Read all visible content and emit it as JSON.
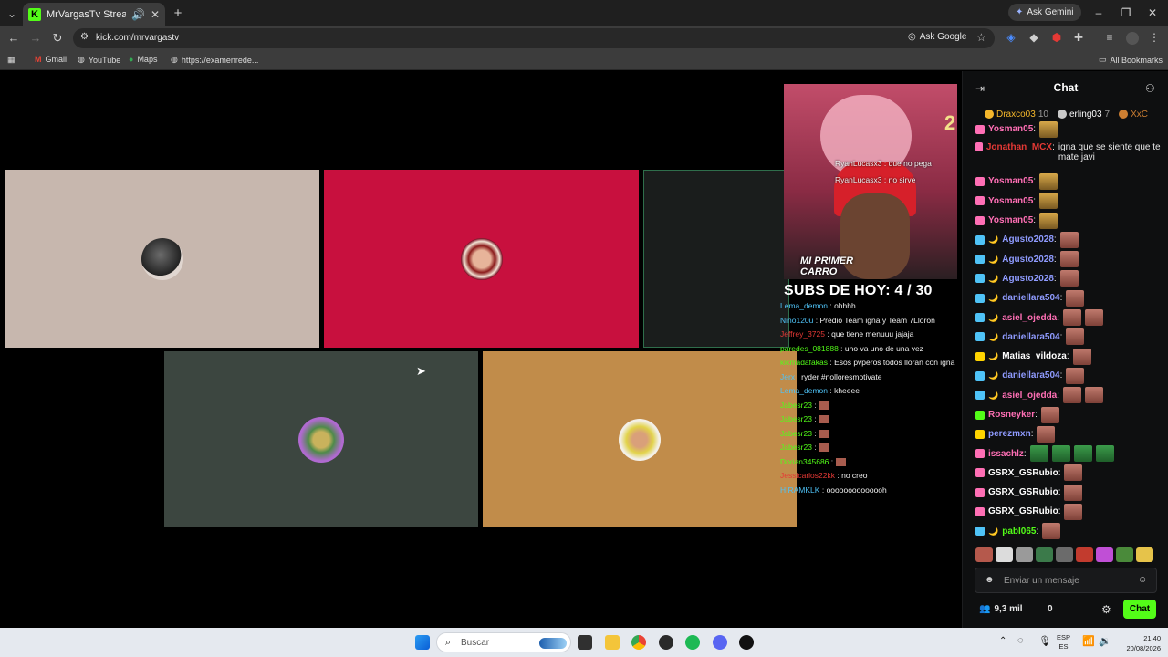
{
  "browser": {
    "tab_title": "MrVargasTv Stream - Watch",
    "url": "kick.com/mrvargastv",
    "ask_google": "Ask Google",
    "ask_gemini": "Ask Gemini",
    "bookmarks": [
      "Gmail",
      "YouTube",
      "Maps",
      "https://examenrede..."
    ],
    "all_bookmarks": "All Bookmarks"
  },
  "stream": {
    "overlay_chat_top": [
      "RyanLucasx3 : que no pega",
      "RyanLucasx3 : no sirve"
    ],
    "cam_label": "MI PRIMER CARRO",
    "subs_banner": "SUBS DE HOY: 4 / 30",
    "overlay_chat": [
      {
        "user": "Lema_demon",
        "msg": "ohhhh",
        "color": "#4fc3f7"
      },
      {
        "user": "Nino120u",
        "msg": "Predio Team igna y Team 7Lloron",
        "color": "#4fc3f7"
      },
      {
        "user": "Jeffrey_3725",
        "msg": "que tiene menuuu jajaja",
        "color": "#e53935"
      },
      {
        "user": "paredes_081888",
        "msg": "uno va uno de una vez",
        "color": "#53fc18"
      },
      {
        "user": "kikmadafakas",
        "msg": "Esos pvperos todos lloran con igna",
        "color": "#53fc18"
      },
      {
        "user": "Jerx",
        "msg": "ryder #nolloresmotivate",
        "color": "#4fc3f7"
      },
      {
        "user": "Lema_demon",
        "msg": "kheeee",
        "color": "#4fc3f7"
      },
      {
        "user": "Jabesr23",
        "msg": "",
        "color": "#53fc18"
      },
      {
        "user": "Jabesr23",
        "msg": "",
        "color": "#53fc18"
      },
      {
        "user": "Jabesr23",
        "msg": "",
        "color": "#53fc18"
      },
      {
        "user": "Jabesr23",
        "msg": "",
        "color": "#53fc18"
      },
      {
        "user": "Dorian345686",
        "msg": "",
        "color": "#53fc18"
      },
      {
        "user": "Jessicarlos22kk",
        "msg": "no creo",
        "color": "#e53935"
      },
      {
        "user": "HIRAMKLK",
        "msg": "oooooooooooooh",
        "color": "#4fc3f7"
      }
    ]
  },
  "chat": {
    "title": "Chat",
    "top_gifters": [
      {
        "name": "Draxco03",
        "count": "10",
        "color": "#f5b72b"
      },
      {
        "name": "erling03",
        "count": "7",
        "color": "#c9c9c9"
      },
      {
        "name": "XxC",
        "count": "",
        "color": "#cd7f32"
      }
    ],
    "messages": [
      {
        "user": "Yosman05",
        "color": "#ff6fb5",
        "text": "",
        "emotes": 1,
        "badge": "#ff6fb5",
        "sub": false
      },
      {
        "user": "Jonathan_MCX",
        "color": "#e53935",
        "text": "igna que se siente que te mate javi",
        "emotes": 0,
        "badge": "#ff6fb5",
        "sub": false
      },
      {
        "user": "Yosman05",
        "color": "#ff6fb5",
        "text": "",
        "emotes": 1,
        "badge": "#ff6fb5",
        "sub": false
      },
      {
        "user": "Yosman05",
        "color": "#ff6fb5",
        "text": "",
        "emotes": 1,
        "badge": "#ff6fb5",
        "sub": false
      },
      {
        "user": "Yosman05",
        "color": "#ff6fb5",
        "text": "",
        "emotes": 1,
        "badge": "#ff6fb5",
        "sub": false
      },
      {
        "user": "Agusto2028",
        "color": "#8f9bff",
        "text": "",
        "emotes": 1,
        "badge": "#4fc3f7",
        "sub": true
      },
      {
        "user": "Agusto2028",
        "color": "#8f9bff",
        "text": "",
        "emotes": 1,
        "badge": "#4fc3f7",
        "sub": true
      },
      {
        "user": "Agusto2028",
        "color": "#8f9bff",
        "text": "",
        "emotes": 1,
        "badge": "#4fc3f7",
        "sub": true
      },
      {
        "user": "daniellara504",
        "color": "#8f9bff",
        "text": "",
        "emotes": 1,
        "badge": "#4fc3f7",
        "sub": true
      },
      {
        "user": "asiel_ojedda",
        "color": "#ff6fb5",
        "text": "",
        "emotes": 2,
        "badge": "#4fc3f7",
        "sub": true
      },
      {
        "user": "daniellara504",
        "color": "#8f9bff",
        "text": "",
        "emotes": 1,
        "badge": "#4fc3f7",
        "sub": true
      },
      {
        "user": "Matias_vildoza",
        "color": "#ffffff",
        "text": "",
        "emotes": 1,
        "badge": "#ffd400",
        "sub": true
      },
      {
        "user": "daniellara504",
        "color": "#8f9bff",
        "text": "",
        "emotes": 1,
        "badge": "#4fc3f7",
        "sub": true
      },
      {
        "user": "asiel_ojedda",
        "color": "#ff6fb5",
        "text": "",
        "emotes": 2,
        "badge": "#4fc3f7",
        "sub": true
      },
      {
        "user": "Rosneyker",
        "color": "#ff6fb5",
        "text": "",
        "emotes": 1,
        "badge": "#53fc18",
        "sub": false
      },
      {
        "user": "perezmxn",
        "color": "#8f9bff",
        "text": "",
        "emotes": 1,
        "badge": "#ffd400",
        "sub": false
      },
      {
        "user": "issachlz",
        "color": "#ff6fb5",
        "text": "",
        "emotes": 4,
        "badge": "#ff6fb5",
        "sub": false
      },
      {
        "user": "GSRX_GSRubio",
        "color": "#ffffff",
        "text": "",
        "emotes": 1,
        "badge": "#ff6fb5",
        "sub": false
      },
      {
        "user": "GSRX_GSRubio",
        "color": "#ffffff",
        "text": "",
        "emotes": 1,
        "badge": "#ff6fb5",
        "sub": false
      },
      {
        "user": "GSRX_GSRubio",
        "color": "#ffffff",
        "text": "",
        "emotes": 1,
        "badge": "#ff6fb5",
        "sub": false
      },
      {
        "user": "pabl065",
        "color": "#53fc18",
        "text": "",
        "emotes": 1,
        "badge": "#4fc3f7",
        "sub": true
      }
    ],
    "input_placeholder": "Enviar un mensaje",
    "viewers": "9,3 mil",
    "points": "0",
    "send_label": "Chat"
  },
  "taskbar": {
    "search_placeholder": "Buscar",
    "lang_top": "ESP",
    "lang_bottom": "ES",
    "time": "21:40",
    "date": "20/08/2026"
  },
  "colors": {
    "kick_green": "#53fc18",
    "tile_1": "#c7b7ae",
    "tile_2": "#c8103e",
    "tile_3": "#1a1d1c",
    "tile_4": "#3c4640",
    "tile_5": "#c18c4a"
  }
}
